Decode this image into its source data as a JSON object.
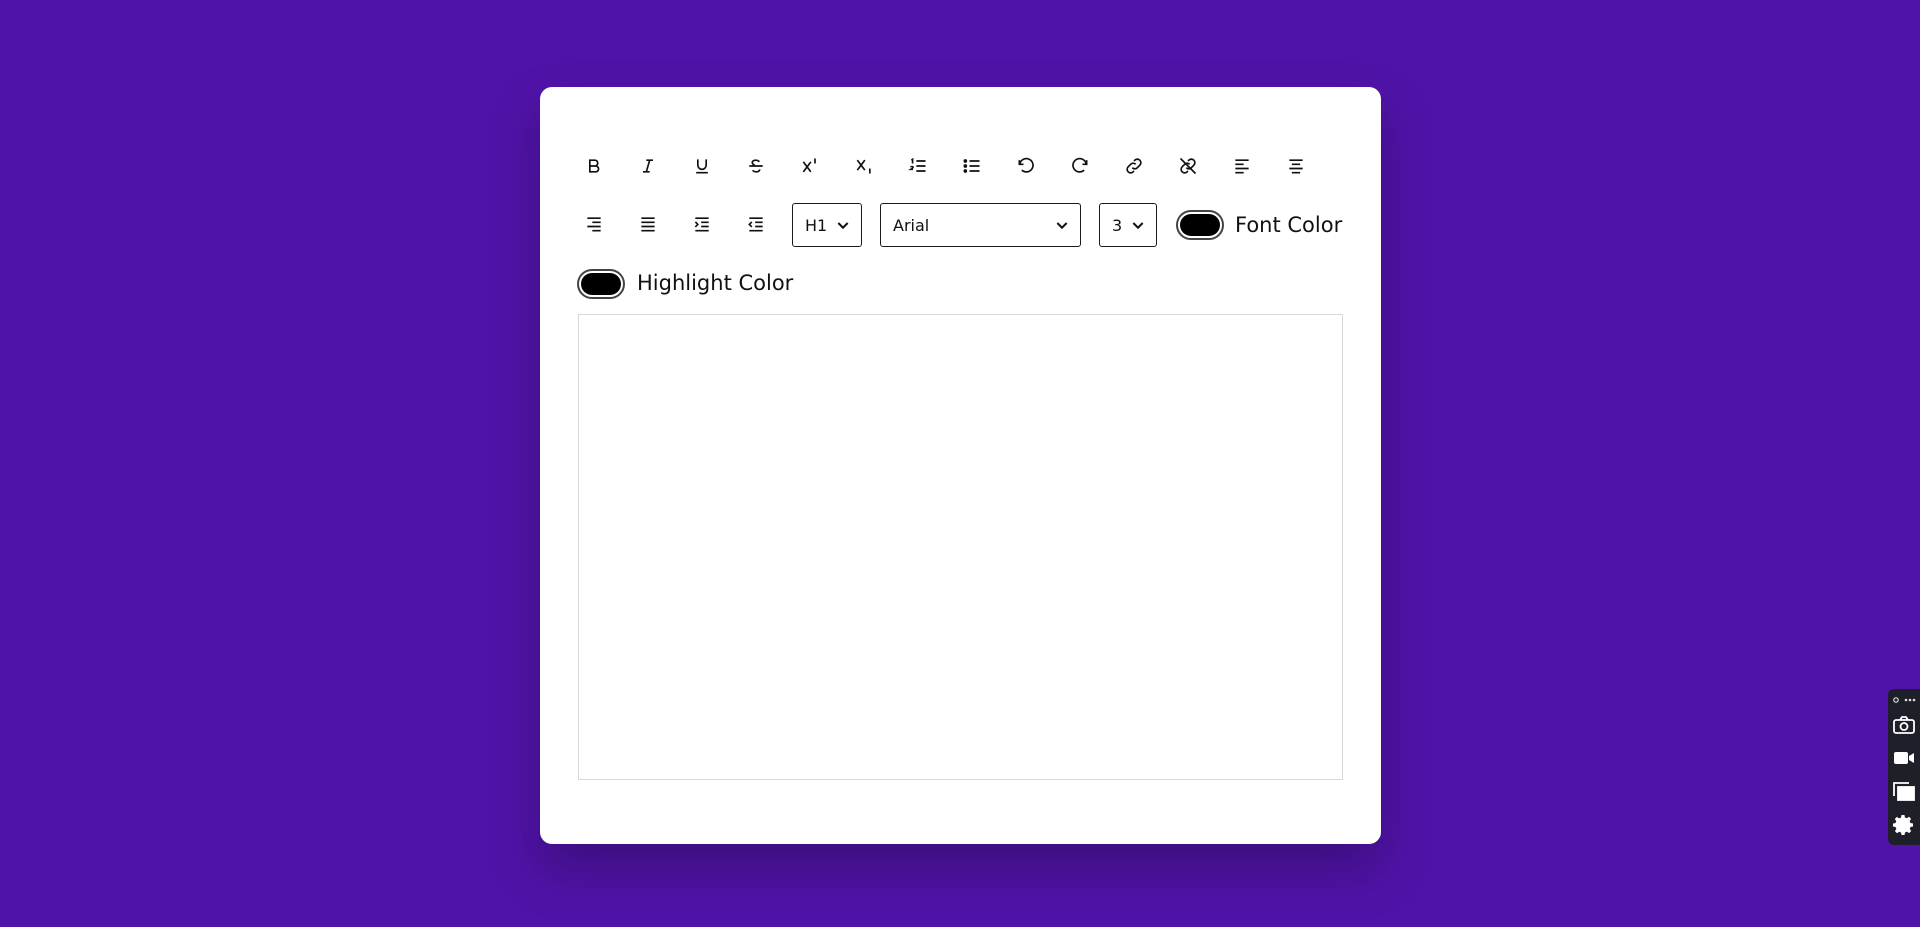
{
  "toolbar": {
    "row1": [
      {
        "name": "bold-button",
        "icon": "bold-icon"
      },
      {
        "name": "italic-button",
        "icon": "italic-icon"
      },
      {
        "name": "underline-button",
        "icon": "underline-icon"
      },
      {
        "name": "strikethrough-button",
        "icon": "strikethrough-icon"
      },
      {
        "name": "superscript-button",
        "icon": "superscript-icon"
      },
      {
        "name": "subscript-button",
        "icon": "subscript-icon"
      },
      {
        "name": "ordered-list-button",
        "icon": "ordered-list-icon"
      },
      {
        "name": "unordered-list-button",
        "icon": "unordered-list-icon"
      },
      {
        "name": "undo-button",
        "icon": "undo-icon"
      },
      {
        "name": "redo-button",
        "icon": "redo-icon"
      },
      {
        "name": "link-button",
        "icon": "link-icon"
      },
      {
        "name": "unlink-button",
        "icon": "unlink-icon"
      },
      {
        "name": "align-left-button",
        "icon": "align-left-icon"
      },
      {
        "name": "align-center-button",
        "icon": "align-center-icon"
      }
    ],
    "row2": [
      {
        "name": "align-right-button",
        "icon": "align-right-icon"
      },
      {
        "name": "justify-button",
        "icon": "justify-icon"
      },
      {
        "name": "indent-button",
        "icon": "indent-icon"
      },
      {
        "name": "outdent-button",
        "icon": "outdent-icon"
      }
    ],
    "heading_select": {
      "value": "H1"
    },
    "font_select": {
      "value": "Arial"
    },
    "size_select": {
      "value": "3"
    },
    "font_color": {
      "label": "Font Color",
      "value": "#000000"
    },
    "highlight_color": {
      "label": "Highlight Color",
      "value": "#000000"
    }
  },
  "editor": {
    "content": ""
  },
  "theme": {
    "background": "#5013a8",
    "card": "#ffffff"
  }
}
